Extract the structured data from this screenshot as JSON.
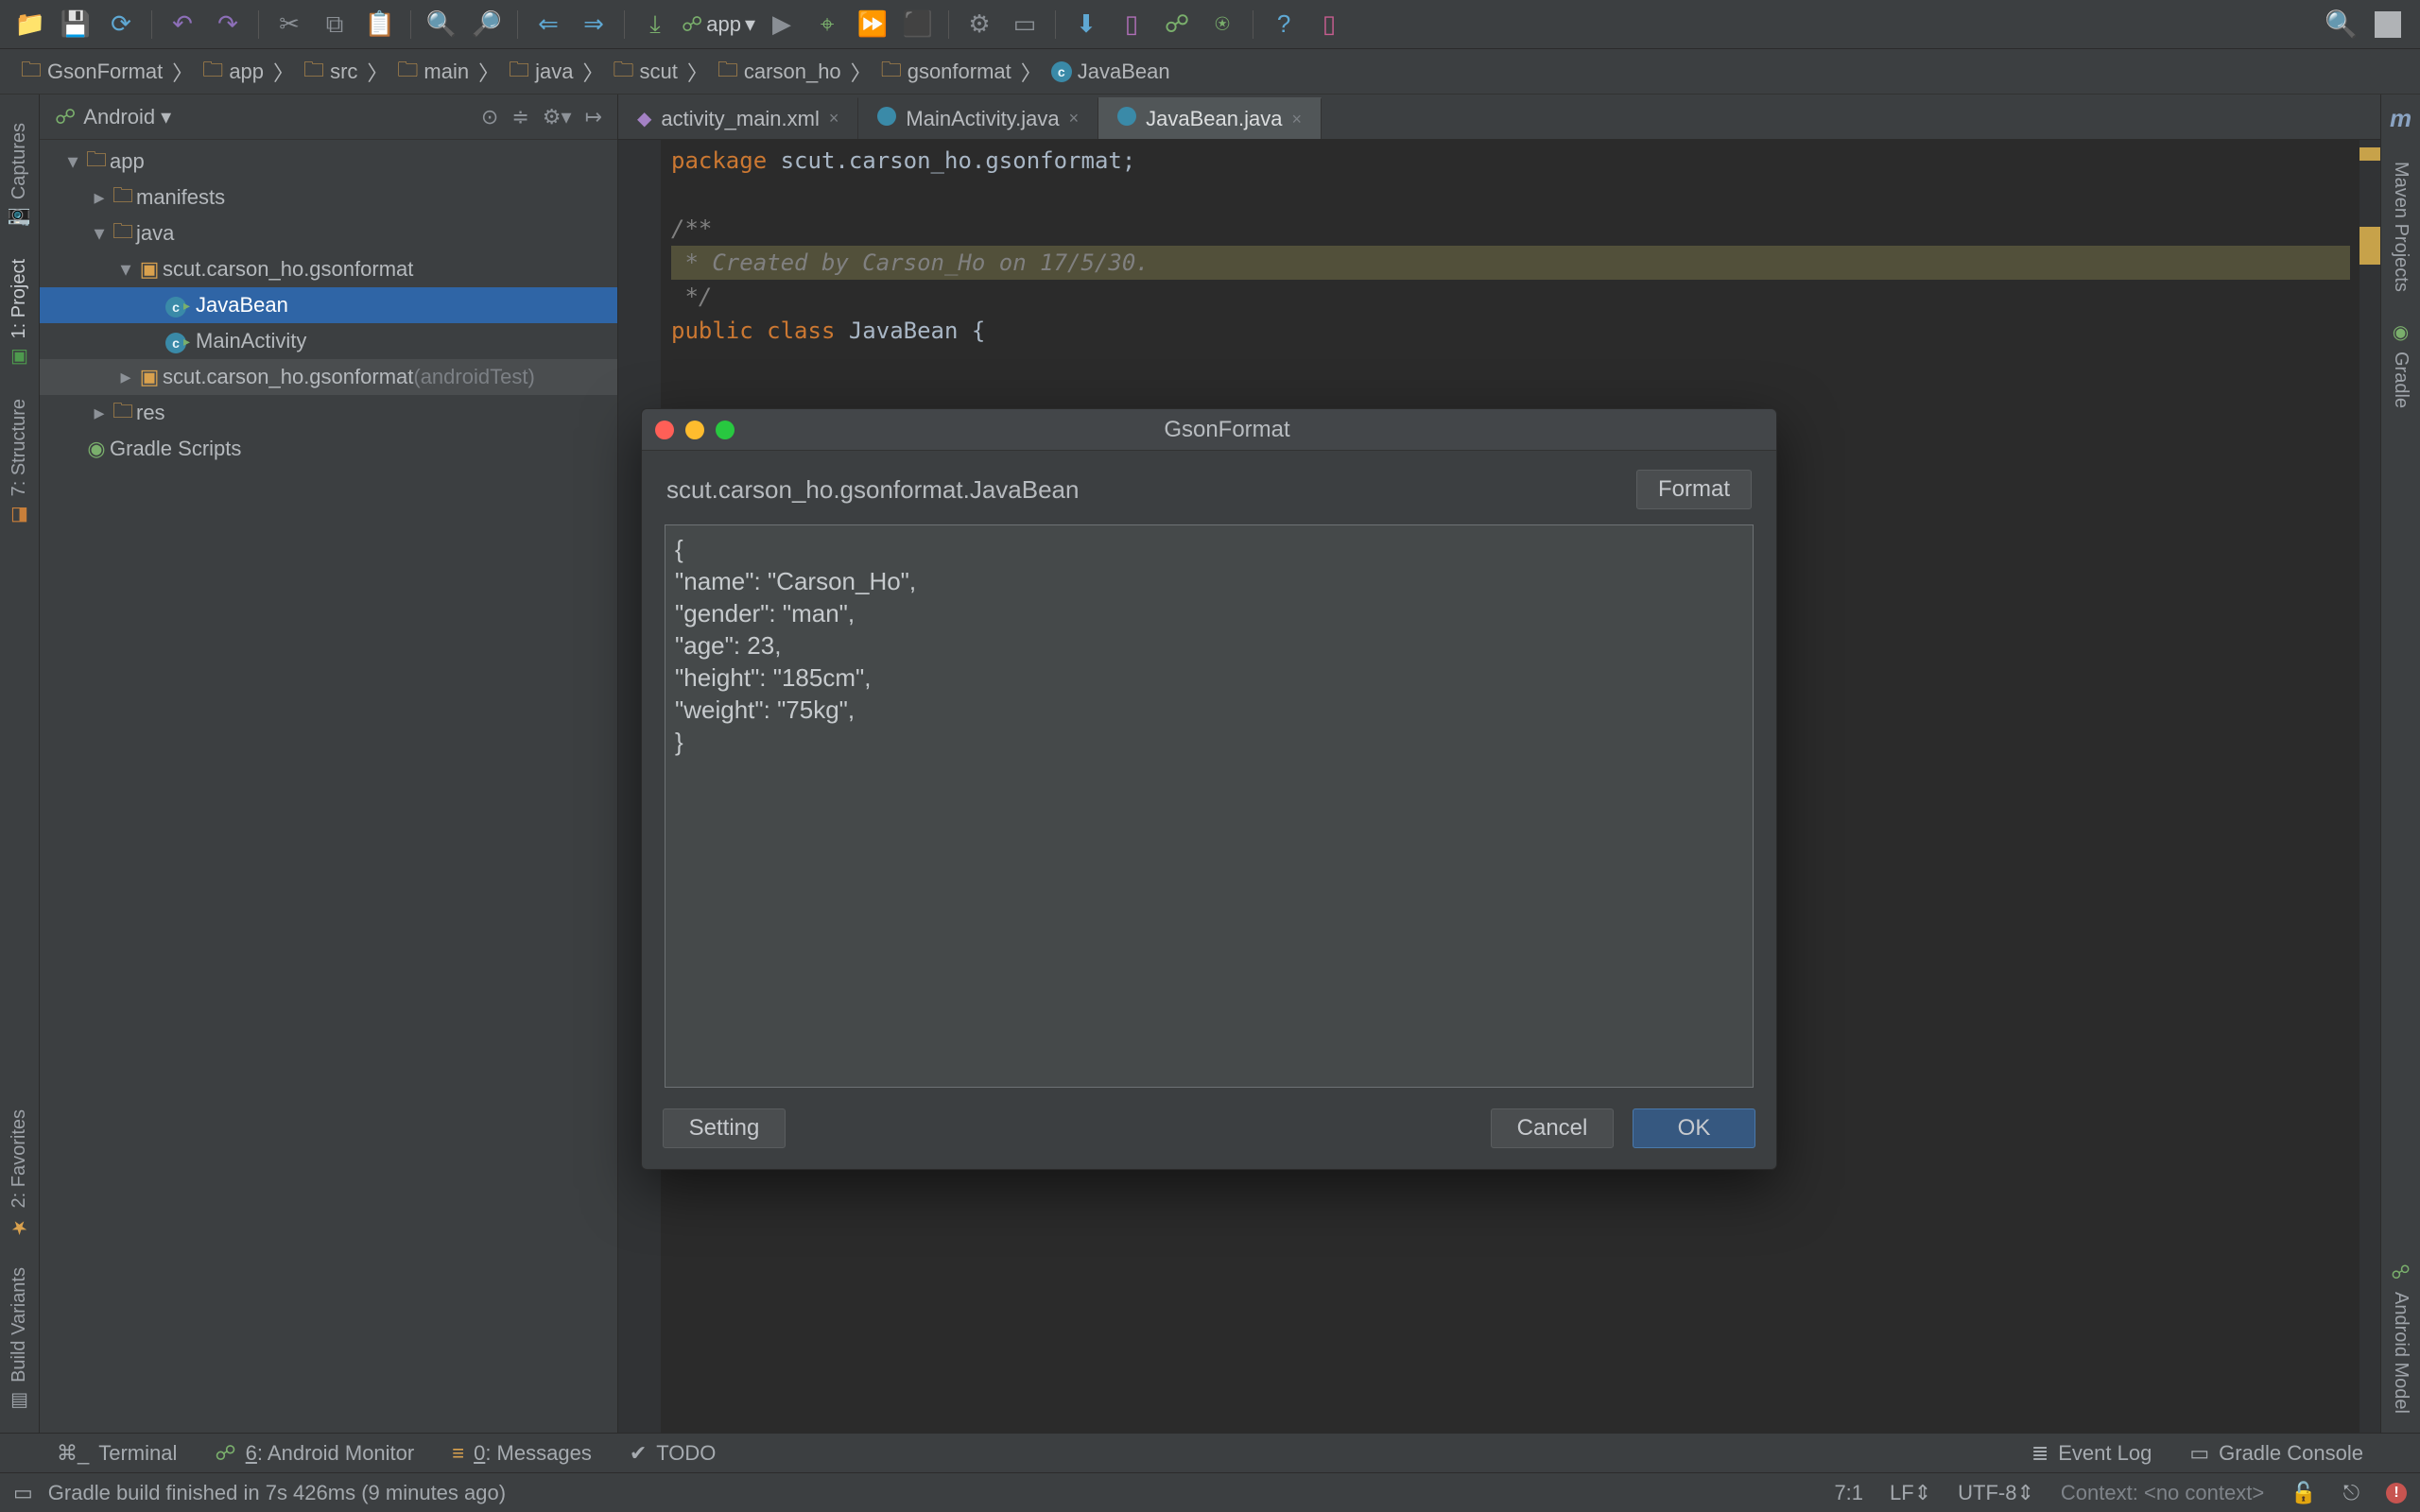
{
  "toolbar": {
    "config": "app"
  },
  "breadcrumbs": [
    "GsonFormat",
    "app",
    "src",
    "main",
    "java",
    "scut",
    "carson_ho",
    "gsonformat",
    "JavaBean"
  ],
  "projectPane": {
    "mode": "Android",
    "rows": [
      {
        "indent": 0,
        "arrow": "down",
        "icon": "folder",
        "label": "app"
      },
      {
        "indent": 1,
        "arrow": "right",
        "icon": "folder",
        "label": "manifests"
      },
      {
        "indent": 1,
        "arrow": "down",
        "icon": "folder",
        "label": "java"
      },
      {
        "indent": 2,
        "arrow": "down",
        "icon": "pkg",
        "label": "scut.carson_ho.gsonformat"
      },
      {
        "indent": 3,
        "arrow": "",
        "icon": "class",
        "label": "JavaBean",
        "selected": true
      },
      {
        "indent": 3,
        "arrow": "",
        "icon": "class",
        "label": "MainActivity"
      },
      {
        "indent": 2,
        "arrow": "right",
        "icon": "pkg",
        "label": "scut.carson_ho.gsonformat",
        "muted": "(androidTest)",
        "sel2": true
      },
      {
        "indent": 1,
        "arrow": "right",
        "icon": "folder",
        "label": "res"
      },
      {
        "indent": 0,
        "arrow": "",
        "icon": "gradle",
        "label": "Gradle Scripts"
      }
    ]
  },
  "leftRails": [
    "Captures",
    "1: Project",
    "7: Structure",
    "2: Favorites",
    "Build Variants"
  ],
  "rightRails": [
    "Maven Projects",
    "Gradle",
    "Android Model"
  ],
  "tabs": [
    {
      "icon": "xml",
      "label": "activity_main.xml",
      "active": false
    },
    {
      "icon": "java",
      "label": "MainActivity.java",
      "active": false
    },
    {
      "icon": "java",
      "label": "JavaBean.java",
      "active": true
    }
  ],
  "editor": {
    "lines": [
      {
        "t": "pkg",
        "text": "package scut.carson_ho.gsonformat;"
      },
      {
        "t": "blank",
        "text": ""
      },
      {
        "t": "cmtO",
        "text": "/**"
      },
      {
        "t": "cmtH",
        "text": " * Created by Carson_Ho on 17/5/30."
      },
      {
        "t": "cmtC",
        "text": " */"
      },
      {
        "t": "cls",
        "text": "public class JavaBean {"
      }
    ]
  },
  "dialog": {
    "title": "GsonFormat",
    "className": "scut.carson_ho.gsonformat.JavaBean",
    "formatLabel": "Format",
    "jsonText": "{\n\"name\": \"Carson_Ho\",\n\"gender\": \"man\",\n\"age\": 23,\n\"height\": \"185cm\",\n\"weight\": \"75kg\",\n}",
    "settingLabel": "Setting",
    "cancelLabel": "Cancel",
    "okLabel": "OK"
  },
  "bottomTools": {
    "terminal": "Terminal",
    "androidMonitor": "6: Android Monitor",
    "messages": "0: Messages",
    "todo": "TODO",
    "eventLog": "Event Log",
    "gradleConsole": "Gradle Console"
  },
  "status": {
    "msg": "Gradle build finished in 7s 426ms (9 minutes ago)",
    "pos": "7:1",
    "lf": "LF",
    "enc": "UTF-8",
    "context": "Context: <no context>"
  }
}
